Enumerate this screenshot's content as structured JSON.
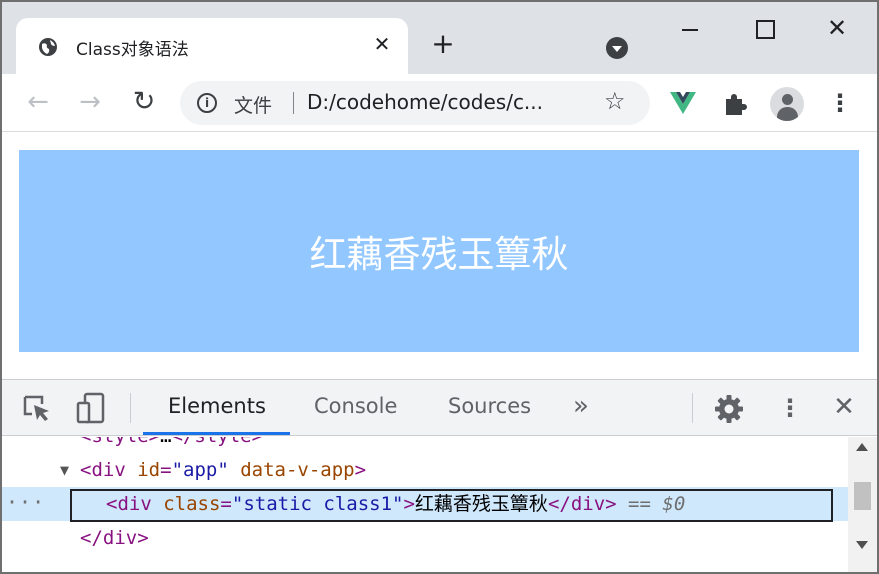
{
  "browser": {
    "tab": {
      "title": "Class对象语法",
      "close_glyph": "✕"
    },
    "new_tab_glyph": "+",
    "window_controls": {
      "close_glyph": "✕"
    },
    "nav": {
      "back_glyph": "←",
      "forward_glyph": "→",
      "reload_glyph": "↻"
    },
    "address": {
      "security_label": "文件",
      "url": "D:/codehome/codes/c...",
      "bookmark_glyph": "☆"
    },
    "menu_glyph": "⋮",
    "extensions": [
      "vue-devtools-icon",
      "puzzle-icon",
      "avatar"
    ]
  },
  "page": {
    "banner_text": "红藕香残玉簟秋",
    "banner_color": "#92c7ff"
  },
  "devtools": {
    "tabs": [
      {
        "label": "Elements",
        "active": true
      },
      {
        "label": "Console",
        "active": false
      },
      {
        "label": "Sources",
        "active": false
      }
    ],
    "more_tabs_glyph": "»",
    "menu_glyph": "⋮",
    "close_glyph": "✕",
    "dom_lines": {
      "line0": {
        "open": "<style>",
        "ellipsis": "…",
        "close": "</style>"
      },
      "line1": {
        "toggle": "▼",
        "tag_open": "<div",
        "attr1": "id",
        "val1": "\"app\"",
        "attr2": "data-v-app",
        "tag_end": ">"
      },
      "line2": {
        "gutter": "···",
        "tag_open": "<div",
        "attr1": "class",
        "val1": "\"static class1\"",
        "tag_end": ">",
        "text": "红藕香残玉簟秋",
        "tag_close": "</div>",
        "eq": "==",
        "ref": "$0"
      },
      "line3": {
        "tag_close": "</div>"
      }
    }
  }
}
